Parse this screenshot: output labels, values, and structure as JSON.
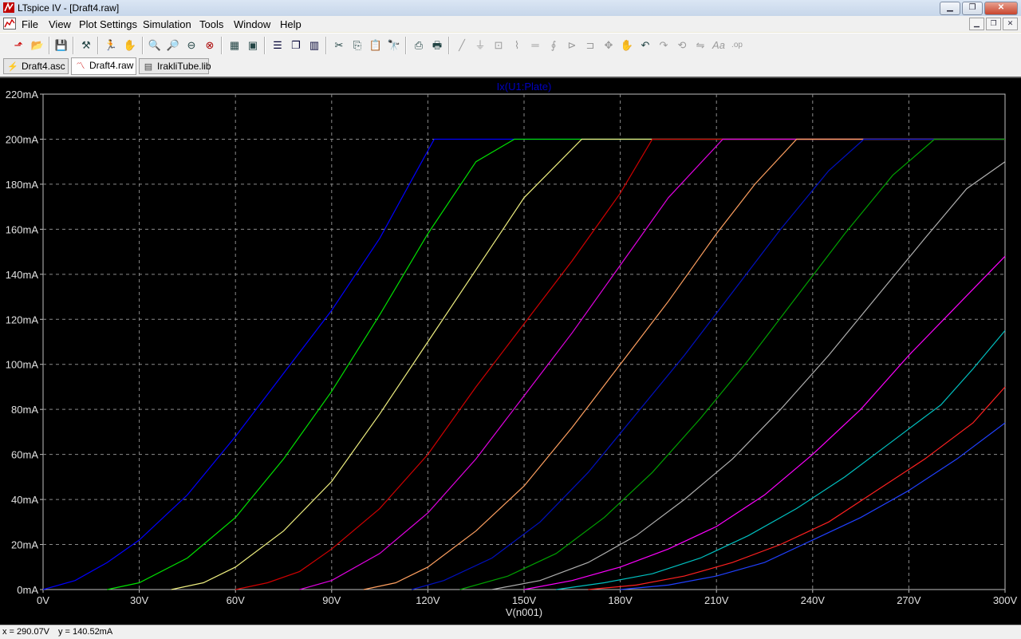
{
  "window": {
    "title": "LTspice IV - [Draft4.raw]"
  },
  "menu": [
    "File",
    "View",
    "Plot Settings",
    "Simulation",
    "Tools",
    "Window",
    "Help"
  ],
  "toolbar_icons": [
    "new-schematic-icon",
    "open-icon",
    "save-icon",
    "control-panel-icon",
    "run-icon",
    "halt-icon",
    "zoom-in-icon",
    "zoom-area-icon",
    "zoom-out-icon",
    "zoom-cancel-icon",
    "autorange-icon",
    "fit-icon",
    "tile-horizontal-icon",
    "cascade-icon",
    "tile-vertical-icon",
    "cut-icon",
    "copy-icon",
    "paste-icon",
    "find-icon",
    "print-setup-icon",
    "print-icon",
    "wire-icon",
    "ground-icon",
    "label-icon",
    "resistor-icon",
    "capacitor-icon",
    "inductor-icon",
    "diode-icon",
    "component-icon",
    "move-icon",
    "drag-icon",
    "undo-icon",
    "redo-icon",
    "rotate-icon",
    "mirror-icon",
    "text-icon",
    "spice-directive-icon"
  ],
  "tabs": [
    {
      "label": "Draft4.asc",
      "icon": "schematic-icon",
      "active": false
    },
    {
      "label": "Draft4.raw",
      "icon": "waveform-icon",
      "active": true
    },
    {
      "label": "IrakliTube.lib",
      "icon": "document-icon",
      "active": false
    }
  ],
  "status": {
    "x": "x = 290.07V",
    "y": "y = 140.52mA"
  },
  "chart_data": {
    "type": "line",
    "title": "Ix(U1:Plate)",
    "title_color": "#0000c0",
    "xlabel": "V(n001)",
    "ylabel": "",
    "xlim": [
      0,
      300
    ],
    "ylim": [
      0,
      220
    ],
    "x_ticks": [
      "0V",
      "30V",
      "60V",
      "90V",
      "120V",
      "150V",
      "180V",
      "210V",
      "240V",
      "270V",
      "300V"
    ],
    "y_ticks": [
      "0mA",
      "20mA",
      "40mA",
      "60mA",
      "80mA",
      "100mA",
      "120mA",
      "140mA",
      "160mA",
      "180mA",
      "200mA",
      "220mA"
    ],
    "grid": true,
    "background": "#000000",
    "series": [
      {
        "color": "#0000ff",
        "points": [
          [
            0,
            0
          ],
          [
            10,
            4
          ],
          [
            20,
            12
          ],
          [
            30,
            22
          ],
          [
            45,
            42
          ],
          [
            60,
            68
          ],
          [
            75,
            96
          ],
          [
            90,
            124
          ],
          [
            105,
            156
          ],
          [
            115,
            182
          ],
          [
            122,
            200
          ],
          [
            300,
            200
          ]
        ]
      },
      {
        "color": "#00e000",
        "points": [
          [
            20,
            0
          ],
          [
            30,
            3
          ],
          [
            45,
            14
          ],
          [
            60,
            32
          ],
          [
            75,
            58
          ],
          [
            90,
            88
          ],
          [
            105,
            122
          ],
          [
            120,
            158
          ],
          [
            135,
            190
          ],
          [
            147,
            200
          ],
          [
            300,
            200
          ]
        ]
      },
      {
        "color": "#f0f080",
        "points": [
          [
            40,
            0
          ],
          [
            50,
            3
          ],
          [
            60,
            10
          ],
          [
            75,
            26
          ],
          [
            90,
            48
          ],
          [
            105,
            78
          ],
          [
            120,
            110
          ],
          [
            135,
            142
          ],
          [
            150,
            174
          ],
          [
            168,
            200
          ],
          [
            300,
            200
          ]
        ]
      },
      {
        "color": "#d00000",
        "points": [
          [
            60,
            0
          ],
          [
            70,
            3
          ],
          [
            80,
            8
          ],
          [
            90,
            18
          ],
          [
            105,
            36
          ],
          [
            120,
            60
          ],
          [
            135,
            90
          ],
          [
            150,
            118
          ],
          [
            165,
            146
          ],
          [
            180,
            176
          ],
          [
            190,
            200
          ],
          [
            300,
            200
          ]
        ]
      },
      {
        "color": "#e000e0",
        "points": [
          [
            80,
            0
          ],
          [
            90,
            4
          ],
          [
            105,
            16
          ],
          [
            120,
            34
          ],
          [
            135,
            58
          ],
          [
            150,
            86
          ],
          [
            165,
            114
          ],
          [
            180,
            144
          ],
          [
            195,
            174
          ],
          [
            212,
            200
          ],
          [
            300,
            200
          ]
        ]
      },
      {
        "color": "#ffa060",
        "points": [
          [
            100,
            0
          ],
          [
            110,
            3
          ],
          [
            120,
            10
          ],
          [
            135,
            26
          ],
          [
            150,
            46
          ],
          [
            165,
            72
          ],
          [
            180,
            100
          ],
          [
            195,
            128
          ],
          [
            210,
            158
          ],
          [
            222,
            180
          ],
          [
            235,
            200
          ],
          [
            300,
            200
          ]
        ]
      },
      {
        "color": "#0010c0",
        "points": [
          [
            115,
            0
          ],
          [
            125,
            4
          ],
          [
            140,
            14
          ],
          [
            155,
            30
          ],
          [
            170,
            52
          ],
          [
            185,
            78
          ],
          [
            200,
            104
          ],
          [
            215,
            132
          ],
          [
            230,
            160
          ],
          [
            245,
            186
          ],
          [
            256,
            200
          ],
          [
            300,
            200
          ]
        ]
      },
      {
        "color": "#00a000",
        "points": [
          [
            130,
            0
          ],
          [
            145,
            6
          ],
          [
            160,
            16
          ],
          [
            175,
            32
          ],
          [
            190,
            52
          ],
          [
            205,
            76
          ],
          [
            220,
            102
          ],
          [
            235,
            130
          ],
          [
            250,
            158
          ],
          [
            265,
            184
          ],
          [
            278,
            200
          ],
          [
            300,
            200
          ]
        ]
      },
      {
        "color": "#b0b0b0",
        "points": [
          [
            140,
            0
          ],
          [
            155,
            4
          ],
          [
            170,
            12
          ],
          [
            185,
            24
          ],
          [
            200,
            40
          ],
          [
            215,
            58
          ],
          [
            230,
            80
          ],
          [
            245,
            104
          ],
          [
            260,
            130
          ],
          [
            275,
            156
          ],
          [
            288,
            178
          ],
          [
            300,
            190
          ]
        ]
      },
      {
        "color": "#ff00ff",
        "points": [
          [
            150,
            0
          ],
          [
            165,
            4
          ],
          [
            180,
            10
          ],
          [
            195,
            18
          ],
          [
            210,
            28
          ],
          [
            225,
            42
          ],
          [
            240,
            60
          ],
          [
            255,
            80
          ],
          [
            270,
            104
          ],
          [
            285,
            126
          ],
          [
            300,
            148
          ]
        ]
      },
      {
        "color": "#00c0c0",
        "points": [
          [
            160,
            0
          ],
          [
            175,
            3
          ],
          [
            190,
            7
          ],
          [
            205,
            14
          ],
          [
            220,
            24
          ],
          [
            235,
            36
          ],
          [
            250,
            50
          ],
          [
            265,
            66
          ],
          [
            280,
            82
          ],
          [
            290,
            98
          ],
          [
            300,
            115
          ]
        ]
      },
      {
        "color": "#ff2020",
        "points": [
          [
            170,
            0
          ],
          [
            185,
            2
          ],
          [
            200,
            6
          ],
          [
            215,
            12
          ],
          [
            230,
            20
          ],
          [
            245,
            30
          ],
          [
            260,
            44
          ],
          [
            275,
            58
          ],
          [
            290,
            74
          ],
          [
            300,
            90
          ]
        ]
      },
      {
        "color": "#2040ff",
        "points": [
          [
            180,
            0
          ],
          [
            195,
            2
          ],
          [
            210,
            6
          ],
          [
            225,
            12
          ],
          [
            240,
            22
          ],
          [
            255,
            32
          ],
          [
            270,
            44
          ],
          [
            285,
            58
          ],
          [
            300,
            74
          ]
        ]
      }
    ]
  }
}
